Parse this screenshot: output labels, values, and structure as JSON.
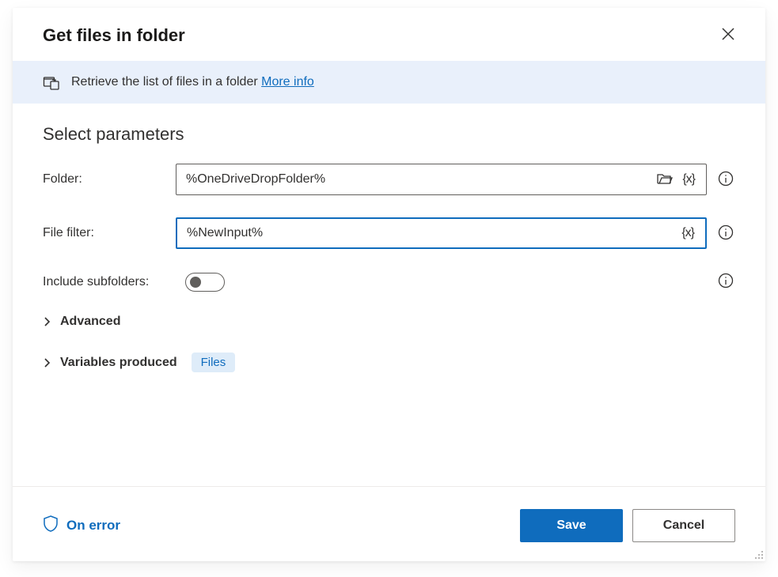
{
  "dialog": {
    "title": "Get files in folder"
  },
  "banner": {
    "text": "Retrieve the list of files in a folder",
    "link_label": "More info"
  },
  "parameters": {
    "section_title": "Select parameters",
    "folder_label": "Folder:",
    "folder_value": "%OneDriveDropFolder%",
    "file_filter_label": "File filter:",
    "file_filter_value": "%NewInput%",
    "include_subfolders_label": "Include subfolders:",
    "include_subfolders_on": false,
    "advanced_label": "Advanced",
    "variables_produced_label": "Variables produced",
    "variables_badge": "Files"
  },
  "footer": {
    "on_error_label": "On error",
    "save_label": "Save",
    "cancel_label": "Cancel"
  }
}
